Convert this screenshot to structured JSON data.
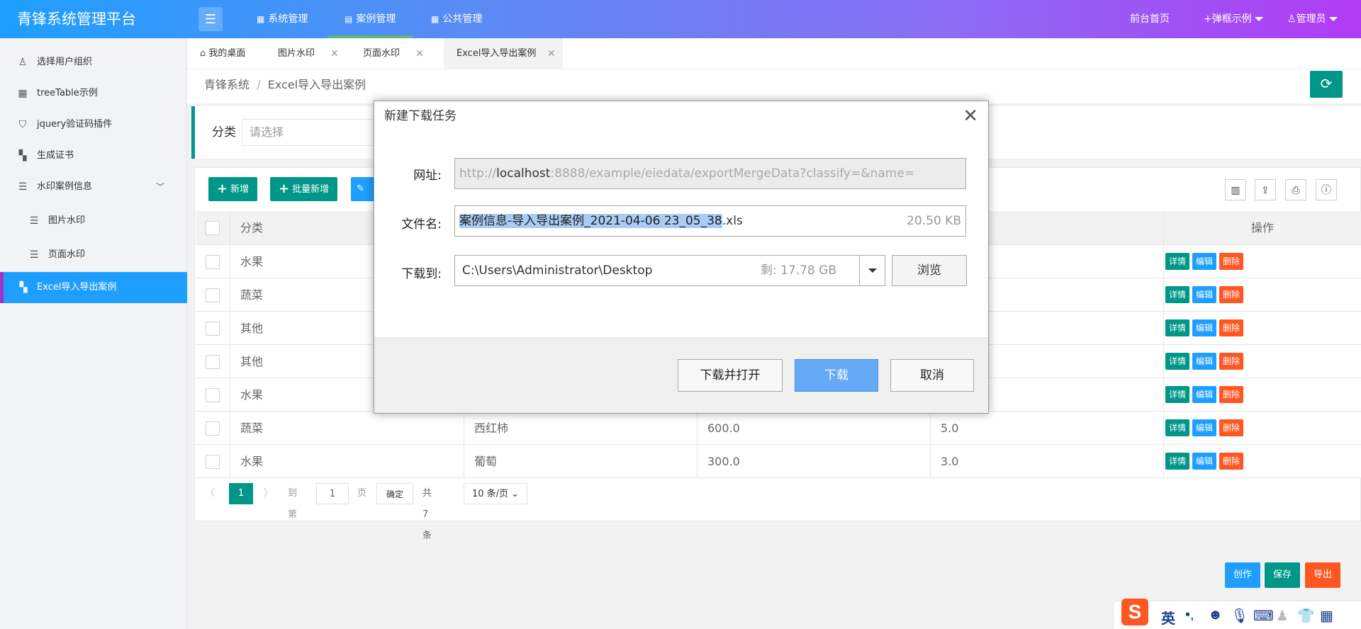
{
  "app": {
    "title": "青锋系统管理平台"
  },
  "topnav": [
    {
      "label": "系统管理",
      "icon": "grid-icon"
    },
    {
      "label": "案例管理",
      "icon": "doc-icon"
    },
    {
      "label": "公共管理",
      "icon": "grid-icon"
    }
  ],
  "topright": {
    "home": "前台首页",
    "popup": "+弹框示例",
    "user": "管理员"
  },
  "sidebar": [
    {
      "label": "选择用户组织",
      "icon": "user-icon"
    },
    {
      "label": "treeTable示例",
      "icon": "table-icon"
    },
    {
      "label": "jquery验证码插件",
      "icon": "shield-icon"
    },
    {
      "label": "生成证书",
      "icon": "grid-icon"
    },
    {
      "label": "水印案例信息",
      "icon": "list-icon"
    },
    {
      "label": "图片水印",
      "icon": "list-icon"
    },
    {
      "label": "页面水印",
      "icon": "list-icon"
    },
    {
      "label": "Excel导入导出案例",
      "icon": "grid-icon"
    }
  ],
  "tabs": [
    "我的桌面",
    "图片水印",
    "页面水印",
    "Excel导入导出案例"
  ],
  "breadcrumb": {
    "root": "青锋系统",
    "sep": "/",
    "current": "Excel导入导出案例"
  },
  "filter": {
    "label": "分类",
    "placeholder": "请选择"
  },
  "toolbar": {
    "add": "新增",
    "batch_add": "批量新增"
  },
  "table": {
    "headers": [
      "分类",
      "操作"
    ],
    "rows": [
      {
        "c1": "水果",
        "c2": "",
        "c3": "",
        "c4": ""
      },
      {
        "c1": "蔬菜",
        "c2": "",
        "c3": "",
        "c4": ""
      },
      {
        "c1": "其他",
        "c2": "",
        "c3": "",
        "c4": ""
      },
      {
        "c1": "其他",
        "c2": "",
        "c3": "",
        "c4": ""
      },
      {
        "c1": "水果",
        "c2": "",
        "c3": "",
        "c4": ""
      },
      {
        "c1": "蔬菜",
        "c2": "西红柿",
        "c3": "600.0",
        "c4": "5.0"
      },
      {
        "c1": "水果",
        "c2": "葡萄",
        "c3": "300.0",
        "c4": "3.0"
      }
    ],
    "ops": {
      "detail": "详情",
      "edit": "编辑",
      "delete": "删除"
    }
  },
  "pager": {
    "current": "1",
    "goto": "到第",
    "page_value": "1",
    "page_unit": "页",
    "confirm": "确定",
    "total": "共 7 条",
    "size": "10 条/页"
  },
  "bottom": {
    "create": "创作",
    "save": "保存",
    "export": "导出"
  },
  "ime": {
    "lang": "英"
  },
  "dialog": {
    "title": "新建下载任务",
    "url_label": "网址:",
    "url_prefix": "http://",
    "url_host": "localhost",
    "url_rest": ":8888/example/eiedata/exportMergeData?classify=&name=",
    "filename_label": "文件名:",
    "filename_selected": "案例信息-导入导出案例_2021-04-06 23_05_38",
    "filename_ext": ".xls",
    "filesize": "20.50 KB",
    "saveto_label": "下载到:",
    "saveto_path": "C:\\Users\\Administrator\\Desktop",
    "free_space": "剩: 17.78 GB",
    "browse": "浏览",
    "btn_open": "下载并打开",
    "btn_download": "下载",
    "btn_cancel": "取消"
  },
  "colors": {
    "teal": "#009688",
    "blue": "#1e9fff",
    "red": "#ff5722"
  }
}
